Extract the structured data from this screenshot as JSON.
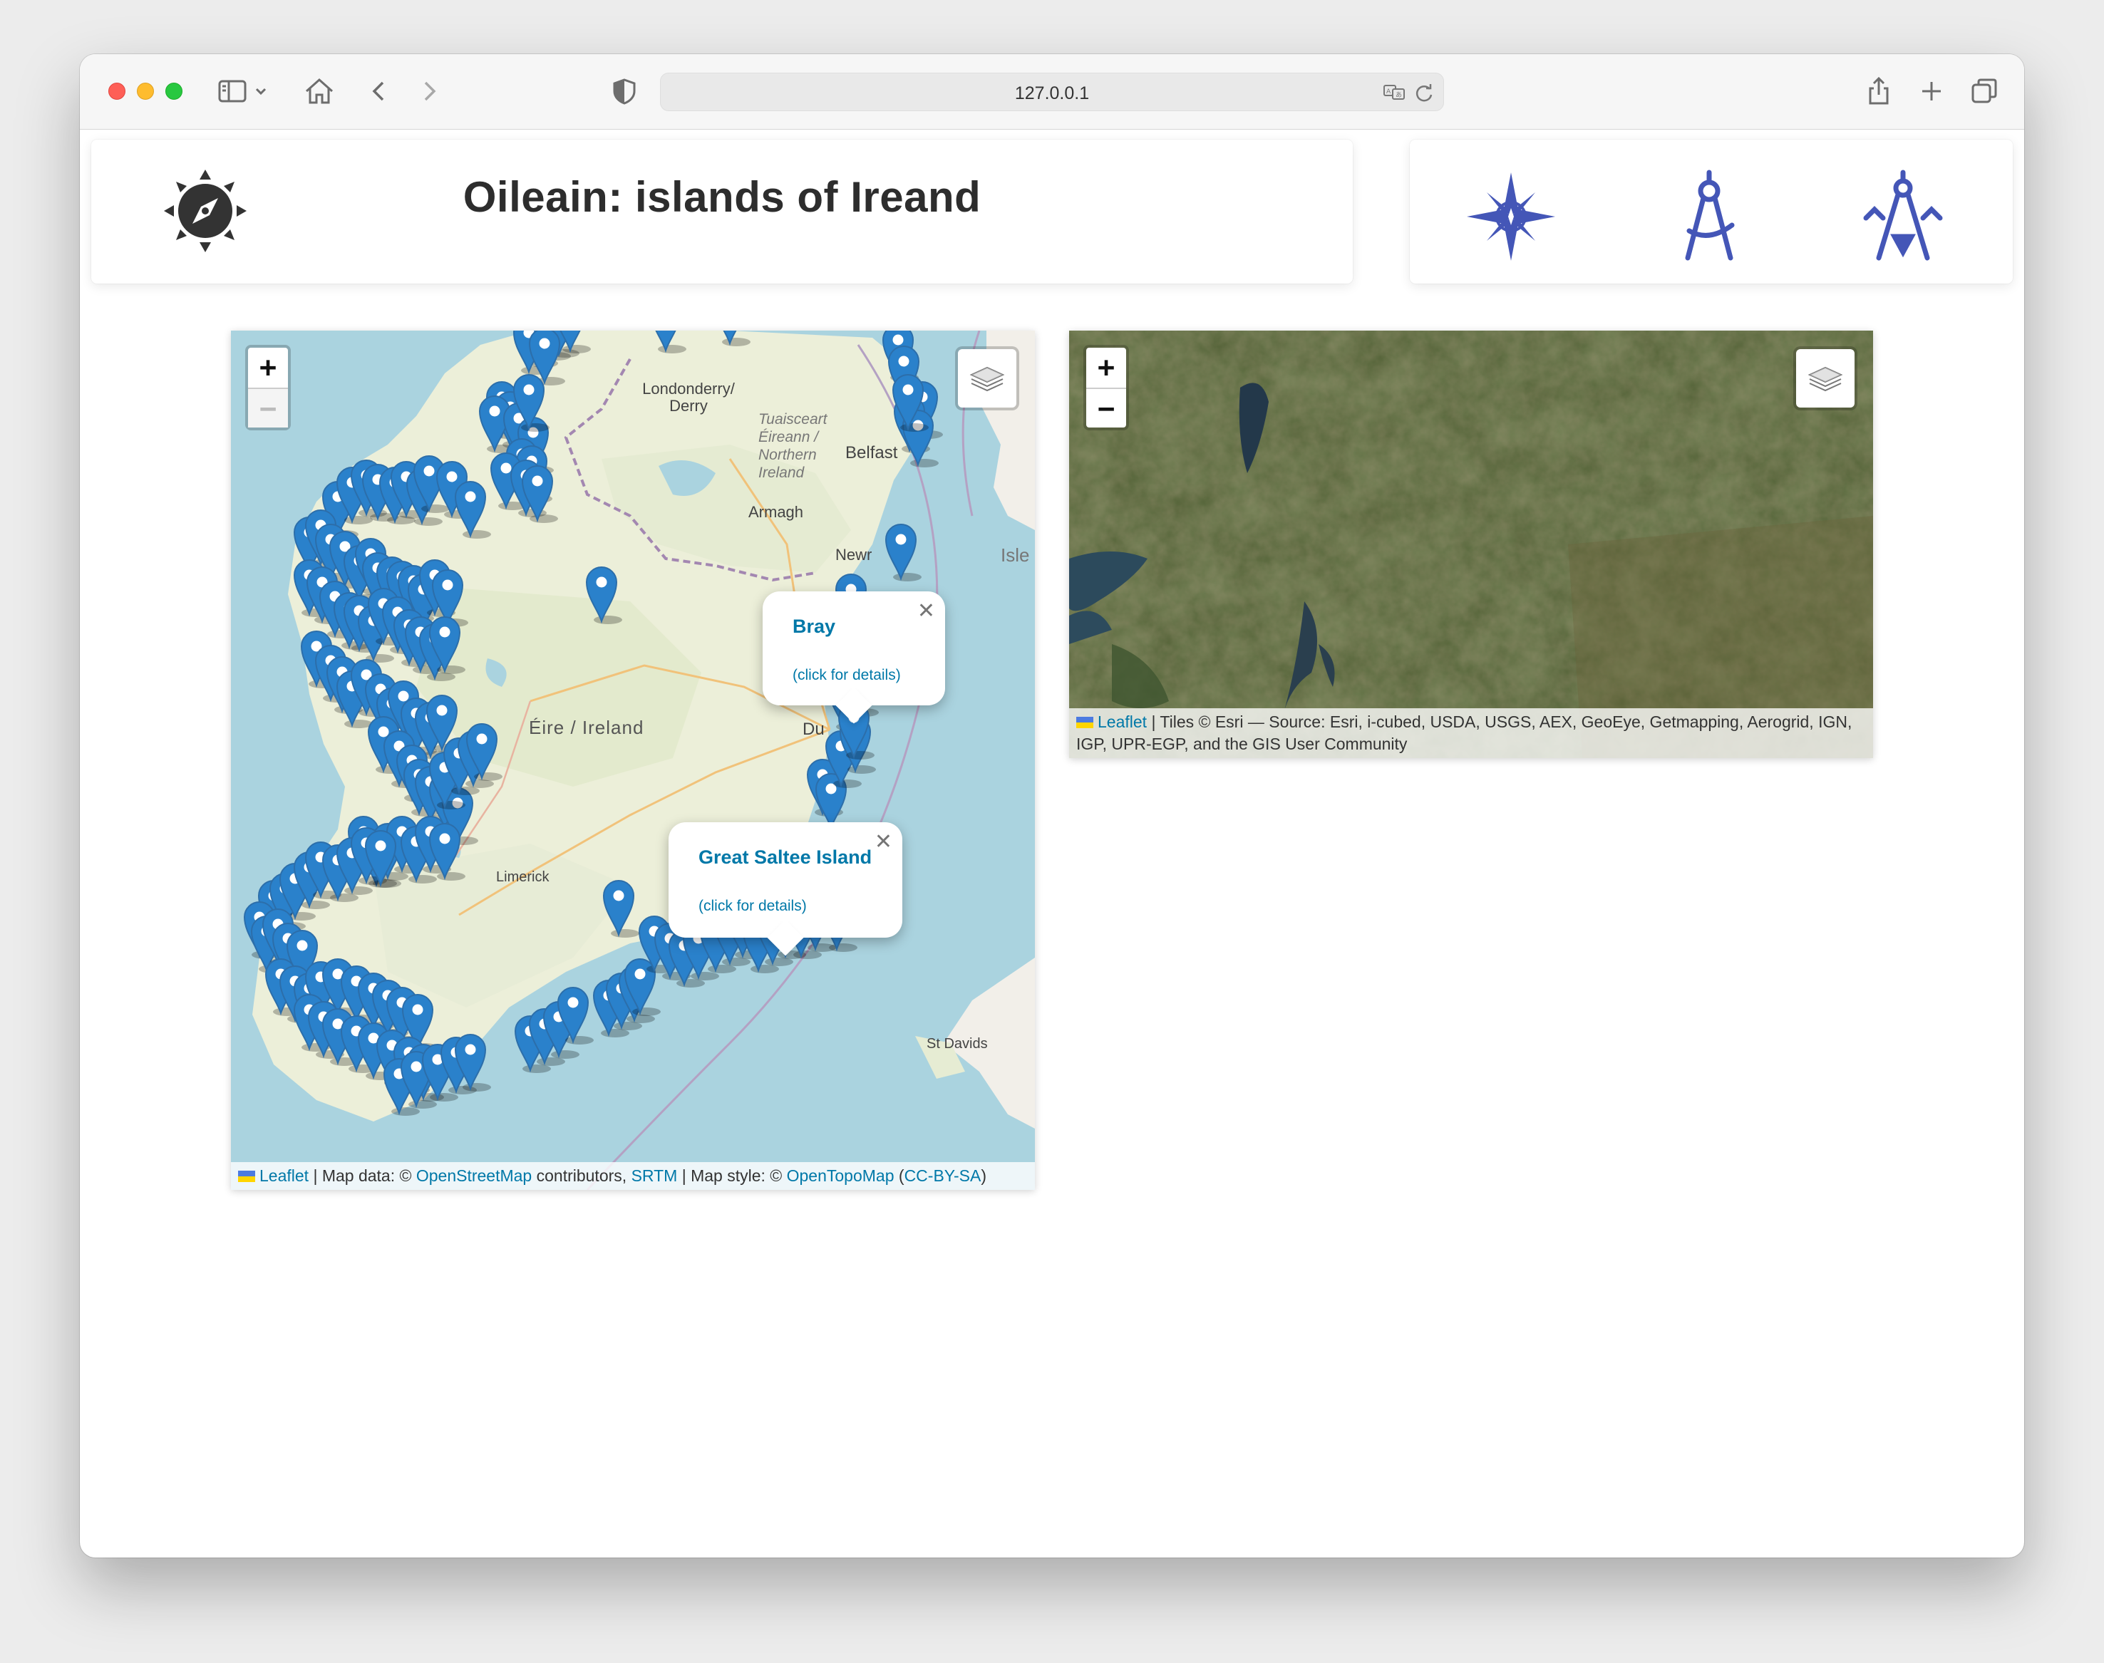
{
  "browser": {
    "url": "127.0.0.1",
    "icons": [
      "sidebar-icon",
      "chevron-down-icon",
      "home-icon",
      "back-icon",
      "forward-icon",
      "shield-icon",
      "translate-icon",
      "reload-icon",
      "share-icon",
      "new-tab-icon",
      "tabs-overview-icon"
    ]
  },
  "header": {
    "title": "Oileain: islands of Ireand",
    "logo_icon": "compass-sun-icon",
    "tools": [
      "compass-rose-icon",
      "drawing-compass-icon",
      "set-square-compass-icon"
    ],
    "accent_color": "#4456b7"
  },
  "topo_map": {
    "zoom_in": "+",
    "zoom_out": "−",
    "layers_icon": "layers-icon",
    "place_labels": {
      "derry": "Londonderry/ Derry",
      "ni": "Tuaisceart Éireann / Northern Ireland",
      "belfast": "Belfast",
      "armagh": "Armagh",
      "newry": "Newr",
      "isle": "Isle",
      "ireland": "Éire / Ireland",
      "dublin": "Du",
      "limerick": "Limerick",
      "stdavids": "St Davids"
    },
    "popups": [
      {
        "name": "Bray",
        "link": "(click for details)"
      },
      {
        "name": "Great Saltee Island",
        "link": "(click for details)"
      }
    ],
    "attribution": {
      "leaflet": "Leaflet",
      "sep1": " | Map data: © ",
      "osm": "OpenStreetMap",
      "contrib": " contributors, ",
      "srtm": "SRTM",
      "style": " | Map style: © ",
      "otm": "OpenTopoMap",
      "lic_open": " (",
      "lic": "CC-BY-SA",
      "lic_close": ")"
    },
    "marker_color": "#2a81cb"
  },
  "sat_map": {
    "zoom_in": "+",
    "zoom_out": "−",
    "layers_icon": "layers-icon",
    "attribution": {
      "leaflet": "Leaflet",
      "text": " | Tiles © Esri — Source: Esri, i-cubed, USDA, USGS, AEX, GeoEye, Getmapping, Aerogrid, IGN, IGP, UPR-EGP, and the GIS User Community"
    }
  }
}
